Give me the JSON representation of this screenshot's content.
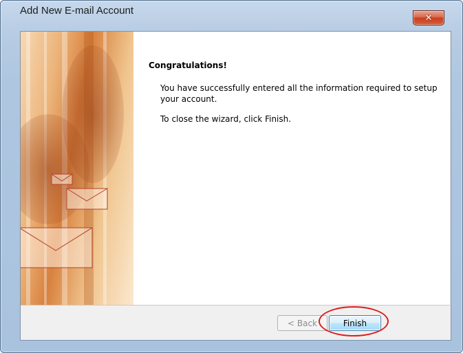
{
  "window": {
    "title": "Add New E-mail Account",
    "close_glyph": "✕"
  },
  "content": {
    "heading": "Congratulations!",
    "message": "You have successfully entered all the information required to setup your account.",
    "instruction": "To close the wizard, click Finish."
  },
  "buttons": {
    "back_label": "< Back",
    "finish_label": "Finish"
  },
  "icons": {
    "close": "close-icon",
    "envelope": "envelope-icon"
  },
  "colors": {
    "highlight": "#e01b1b",
    "banner_accent": "#d8813e",
    "envelope_stroke": "#b3412a"
  }
}
